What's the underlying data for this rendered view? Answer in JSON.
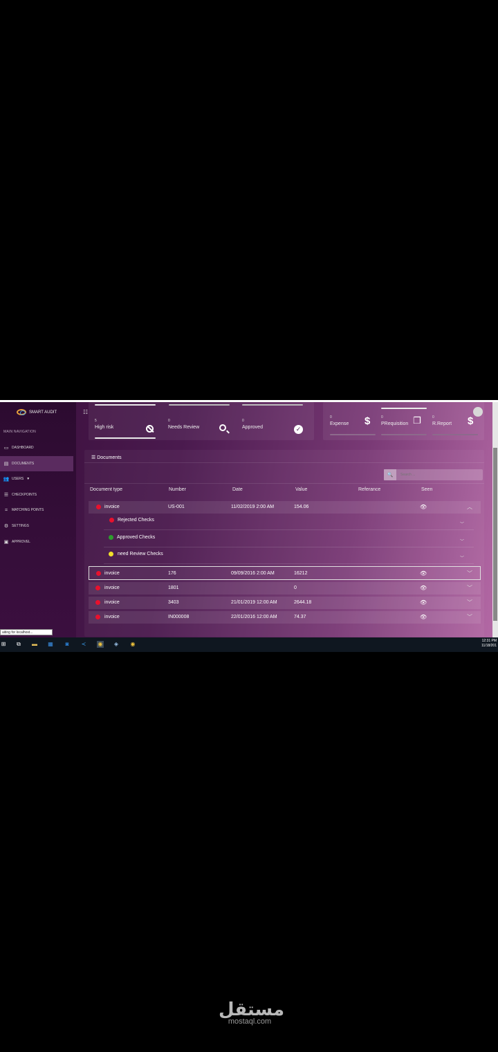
{
  "app": {
    "logo_text": "SMART AUDIT"
  },
  "sidebar": {
    "heading": "MAIN NAVIGATION",
    "items": [
      {
        "label": "DASHBOARD",
        "icon": "monitor-icon"
      },
      {
        "label": "DOCUMENTS",
        "icon": "file-icon",
        "active": true
      },
      {
        "label": "USERS",
        "icon": "users-icon",
        "has_caret": true
      },
      {
        "label": "CHECKPOINTS",
        "icon": "list-icon"
      },
      {
        "label": "MATCHING POINTS",
        "icon": "equals-icon"
      },
      {
        "label": "SETTINGS",
        "icon": "gears-icon"
      },
      {
        "label": "APPROVEL",
        "icon": "form-icon"
      }
    ]
  },
  "stats_left": [
    {
      "count": "5",
      "label": "High risk",
      "icon": "ban-icon"
    },
    {
      "count": "0",
      "label": "Needs Review",
      "icon": "search-icon"
    },
    {
      "count": "0",
      "label": "Approved",
      "icon": "check-circle-icon"
    }
  ],
  "stats_right": [
    {
      "count": "0",
      "label": "Expense",
      "icon": "dollar-icon"
    },
    {
      "count": "0",
      "label": "PRequisition",
      "icon": "copy-icon"
    },
    {
      "count": "0",
      "label": "R.Report",
      "icon": "dollar-icon"
    }
  ],
  "documents": {
    "title": "Documents",
    "search_placeholder": "Search ...",
    "columns": [
      "Document type",
      "Number",
      "Date",
      "Value",
      "Referance",
      "Seen"
    ],
    "rows": [
      {
        "type": "invoice",
        "number": "US-001",
        "date": "11/02/2019 2:00 AM",
        "value": "154.06",
        "expanded": true
      },
      {
        "type": "invoice",
        "number": "176",
        "date": "09/09/2016 2:00 AM",
        "value": "16212"
      },
      {
        "type": "invoice",
        "number": "1801",
        "date": "",
        "value": "0"
      },
      {
        "type": "invoice",
        "number": "3403",
        "date": "21/01/2019 12:00 AM",
        "value": "2644.18"
      },
      {
        "type": "invoice",
        "number": "IN000008",
        "date": "22/01/2016 12:00 AM",
        "value": "74.37"
      }
    ],
    "sub_items": [
      {
        "label": "Rejected Checks",
        "status_color": "#e8112d"
      },
      {
        "label": "Approved Checks",
        "status_color": "#2e9c2e"
      },
      {
        "label": "need Review Checks",
        "status_color": "#f1e02a"
      }
    ]
  },
  "status_tooltip": "aiting for localhost...",
  "taskbar": {
    "time": "12:31 PM",
    "date": "11/18/201"
  },
  "watermark": {
    "arabic": "مستقل",
    "latin": "mostaql.com"
  }
}
